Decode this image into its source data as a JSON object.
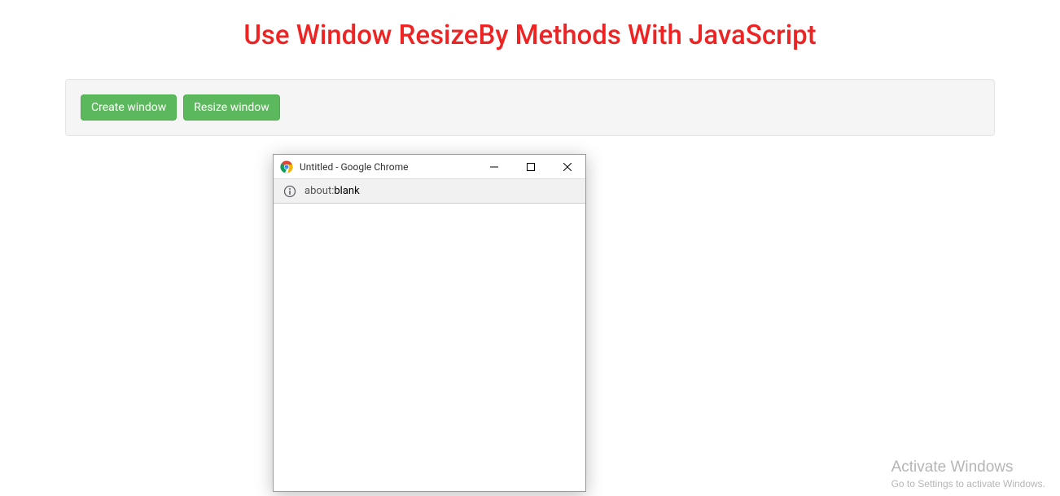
{
  "header": {
    "title": "Use Window ResizeBy Methods With JavaScript"
  },
  "panel": {
    "buttons": {
      "create": "Create window",
      "resize": "Resize window"
    }
  },
  "popup": {
    "title": "Untitled - Google Chrome",
    "url_prefix": "about:",
    "url_path": "blank"
  },
  "watermark": {
    "title": "Activate Windows",
    "subtitle": "Go to Settings to activate Windows."
  }
}
